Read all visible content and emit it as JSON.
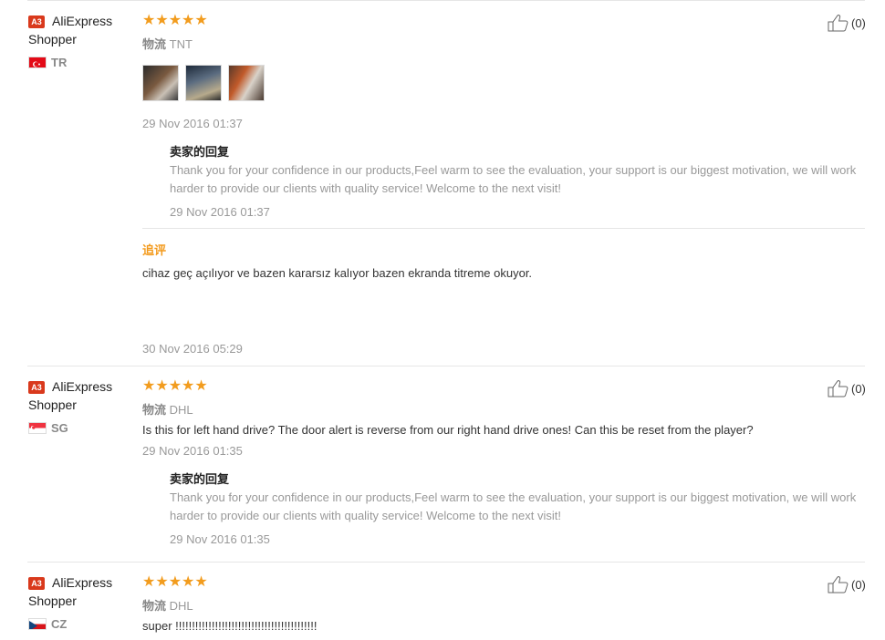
{
  "reviews": [
    {
      "badge": "A3",
      "user_line1": "AliExpress",
      "user_line2": "Shopper",
      "country": "TR",
      "logistics_label": "物流",
      "logistics": "TNT",
      "comment": "",
      "date": "29 Nov 2016 01:37",
      "reply_title": "卖家的回复",
      "reply": "Thank you for your confidence in our products,Feel warm to see the evaluation, your support is our biggest motivation, we will work harder to provide our clients with quality service! Welcome to the next visit!",
      "reply_date": "29 Nov 2016 01:37",
      "additional_title": "追评",
      "additional_text": "cihaz geç açılıyor ve bazen kararsız kalıyor bazen ekranda titreme okuyor.",
      "additional_date": "30 Nov 2016 05:29",
      "likes": "(0)",
      "rating": 5
    },
    {
      "badge": "A3",
      "user_line1": "AliExpress",
      "user_line2": "Shopper",
      "country": "SG",
      "logistics_label": "物流",
      "logistics": "DHL",
      "comment": "Is this for left hand drive? The door alert is reverse from our right hand drive ones! Can this be reset from the player?",
      "date": "29 Nov 2016 01:35",
      "reply_title": "卖家的回复",
      "reply": "Thank you for your confidence in our products,Feel warm to see the evaluation, your support is our biggest motivation, we will work harder to provide our clients with quality service! Welcome to the next visit!",
      "reply_date": "29 Nov 2016 01:35",
      "likes": "(0)",
      "rating": 5
    },
    {
      "badge": "A3",
      "user_line1": "AliExpress",
      "user_line2": "Shopper",
      "country": "CZ",
      "logistics_label": "物流",
      "logistics": "DHL",
      "comment": "super !!!!!!!!!!!!!!!!!!!!!!!!!!!!!!!!!!!!!!!!!!!",
      "likes": "(0)",
      "rating": 5
    }
  ],
  "stars_text": "★★★★★",
  "colors": {
    "star": "#f29c1e",
    "badge": "#d9391c",
    "additional": "#f39a1c"
  }
}
